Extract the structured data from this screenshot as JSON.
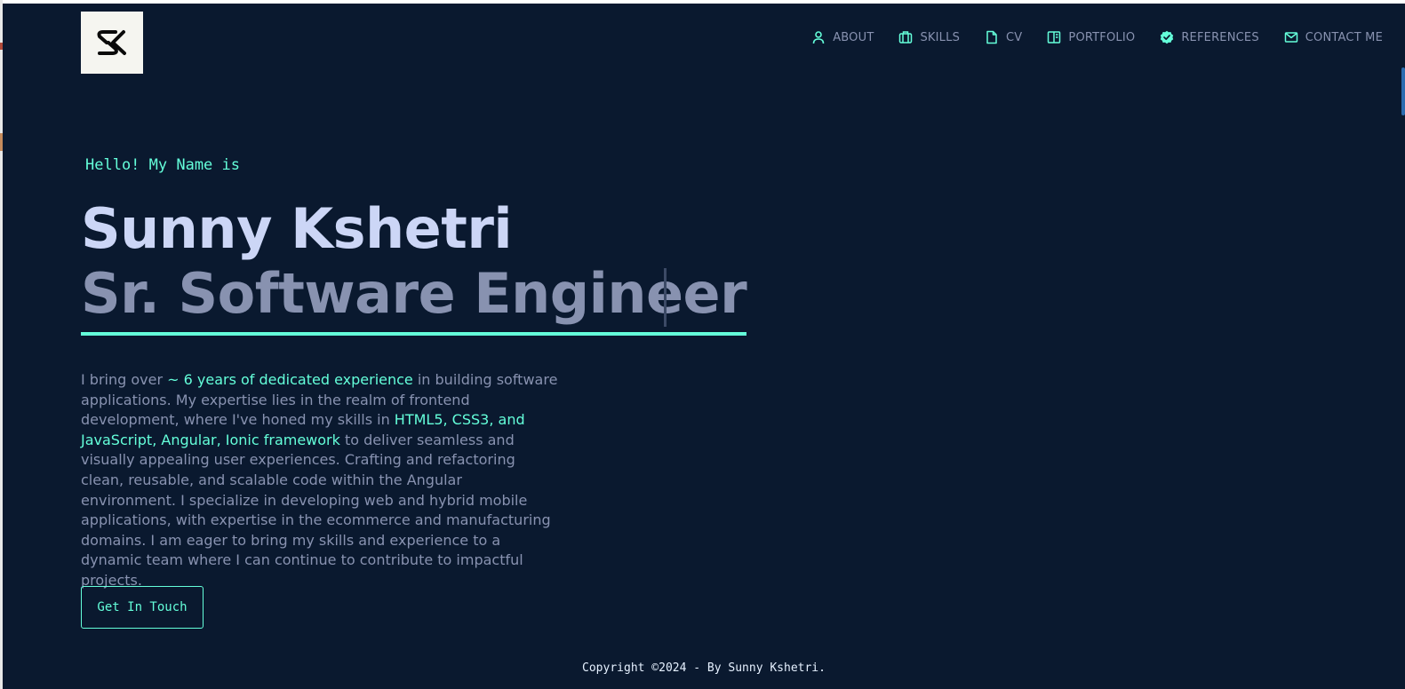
{
  "nav": {
    "items": [
      {
        "label": "ABOUT",
        "icon": "user-icon"
      },
      {
        "label": "SKILLS",
        "icon": "briefcase-icon"
      },
      {
        "label": "CV",
        "icon": "document-icon"
      },
      {
        "label": "PORTFOLIO",
        "icon": "book-open-icon"
      },
      {
        "label": "REFERENCES",
        "icon": "badge-check-icon"
      },
      {
        "label": "CONTACT ME",
        "icon": "mail-icon"
      }
    ]
  },
  "hero": {
    "greeting": "Hello! My Name is",
    "name": "Sunny Kshetri",
    "role": "Sr. Software Engineer",
    "bio": {
      "p1": "I bring over ",
      "h1": "~ 6 years of dedicated experience",
      "p2": " in building software applications. My expertise lies in the realm of frontend development, where I've honed my skills in ",
      "h2": "HTML5, CSS3, and JavaScript, Angular, Ionic framework",
      "p3": " to deliver seamless and visually appealing user experiences. Crafting and refactoring clean, reusable, and scalable code within the Angular environment. I specialize in developing web and hybrid mobile applications, with expertise in the ecommerce and manufacturing domains. I am eager to bring my skills and experience to a dynamic team where I can continue to contribute to impactful projects."
    },
    "cta_label": "Get In Touch"
  },
  "footer": {
    "copyright": "Copyright ©2024 - By Sunny Kshetri."
  },
  "colors": {
    "background": "#0a192f",
    "accent": "#64ffda",
    "heading": "#ccd6f6",
    "muted": "#8892b0",
    "logo_bg": "#f5f5f0"
  }
}
